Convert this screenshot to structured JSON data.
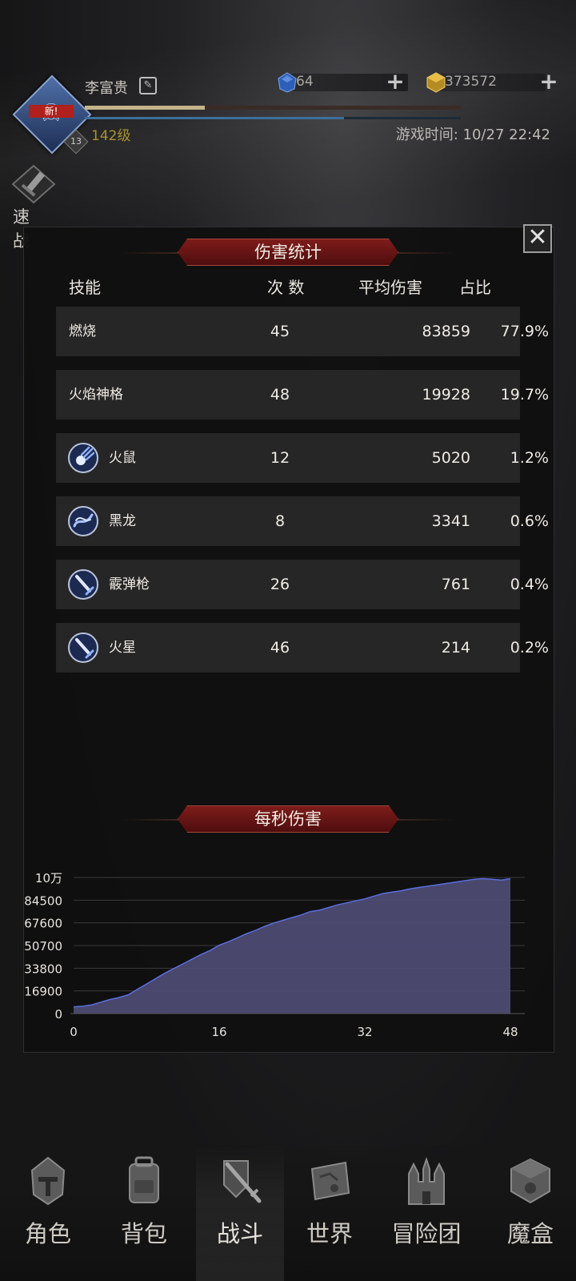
{
  "player": {
    "name": "李富贵",
    "new_badge": "新!",
    "rank": "13",
    "level": "142级",
    "exp_progress": 0.32,
    "secondary_progress": 0.69
  },
  "currency": {
    "gems": "64",
    "gold": "373572"
  },
  "game_time": "游戏时间: 10/27 22:42",
  "quick_fight_label": "速 战",
  "damage_stats": {
    "title": "伤害统计",
    "headers": {
      "skill": "技能",
      "count": "次 数",
      "avg": "平均伤害",
      "ratio": "占比"
    },
    "rows": [
      {
        "skill": "燃烧",
        "count": "45",
        "avg": "83859",
        "ratio": "77.9%",
        "icon": "none"
      },
      {
        "skill": "火焰神格",
        "count": "48",
        "avg": "19928",
        "ratio": "19.7%",
        "icon": "none"
      },
      {
        "skill": "火鼠",
        "count": "12",
        "avg": "5020",
        "ratio": "1.2%",
        "icon": "comet-skill-icon"
      },
      {
        "skill": "黑龙",
        "count": "8",
        "avg": "3341",
        "ratio": "0.6%",
        "icon": "dragon-skill-icon"
      },
      {
        "skill": "霰弹枪",
        "count": "26",
        "avg": "761",
        "ratio": "0.4%",
        "icon": "sword-skill-icon"
      },
      {
        "skill": "火星",
        "count": "46",
        "avg": "214",
        "ratio": "0.2%",
        "icon": "sword-skill-icon"
      }
    ]
  },
  "dps_title": "每秒伤害",
  "chart_data": {
    "type": "area",
    "title": "每秒伤害",
    "xlabel": "",
    "ylabel": "",
    "x_ticks": [
      "0",
      "16",
      "32",
      "48"
    ],
    "y_ticks": [
      "0",
      "16900",
      "33800",
      "50700",
      "67600",
      "84500",
      "10万"
    ],
    "xlim": [
      0,
      48
    ],
    "ylim": [
      0,
      101400
    ],
    "x": [
      0,
      1,
      2,
      3,
      4,
      5,
      6,
      7,
      8,
      9,
      10,
      11,
      12,
      13,
      14,
      15,
      16,
      17,
      18,
      19,
      20,
      21,
      22,
      23,
      24,
      25,
      26,
      27,
      28,
      29,
      30,
      31,
      32,
      33,
      34,
      35,
      36,
      37,
      38,
      39,
      40,
      41,
      42,
      43,
      44,
      45,
      46,
      47,
      48
    ],
    "values": [
      5000,
      5500,
      6500,
      8500,
      10500,
      12000,
      14000,
      18000,
      22000,
      26000,
      30000,
      33500,
      37000,
      40500,
      44000,
      47000,
      51000,
      53500,
      56500,
      59500,
      62000,
      65000,
      67500,
      69500,
      71500,
      73500,
      76000,
      77000,
      79000,
      81000,
      82500,
      84000,
      85500,
      87500,
      89500,
      90500,
      91500,
      93000,
      94000,
      95000,
      96000,
      97000,
      98000,
      99000,
      100000,
      100500,
      100000,
      99500,
      100500
    ],
    "fill_color": "#4d4b72",
    "line_color": "#5a6ee0",
    "grid": true
  },
  "nav": [
    {
      "label": "角色",
      "icon": "helmet-icon",
      "active": false
    },
    {
      "label": "背包",
      "icon": "backpack-icon",
      "active": false
    },
    {
      "label": "战斗",
      "icon": "crossed-swords-icon",
      "active": true
    },
    {
      "label": "世界",
      "icon": "scroll-map-icon",
      "active": false
    },
    {
      "label": "冒险团",
      "icon": "castle-icon",
      "active": false
    },
    {
      "label": "魔盒",
      "icon": "magic-box-icon",
      "active": false
    }
  ]
}
